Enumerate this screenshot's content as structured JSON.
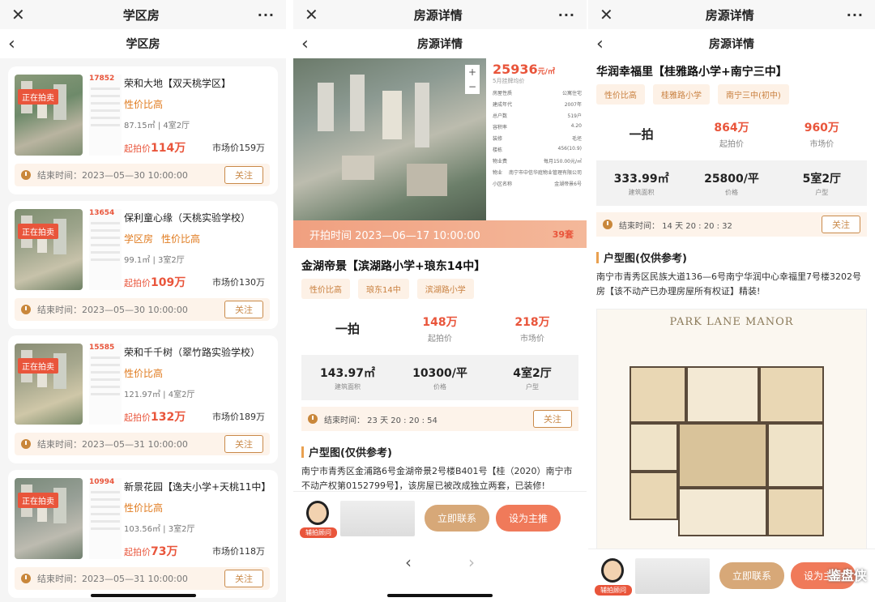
{
  "screen1": {
    "topbar_title": "学区房",
    "close_glyph": "✕",
    "more_glyph": "···",
    "nav_title": "学区房",
    "back_glyph": "‹",
    "cards": [
      {
        "badge": "正在拍卖",
        "doc_price": "17852",
        "title": "荣和大地【双天桃学区】",
        "tags": [
          "性价比高"
        ],
        "area": "87.15㎡",
        "layout": "4室2厅",
        "start_label": "起拍价",
        "start_price": "114万",
        "market": "市场价159万",
        "end": "结束时间：2023—05—30 10:00:00",
        "follow": "关注"
      },
      {
        "badge": "正在拍卖",
        "doc_price": "13654",
        "title": "保利童心缘（天桃实验学校）",
        "tags": [
          "学区房",
          "性价比高"
        ],
        "area": "99.1㎡",
        "layout": "3室2厅",
        "start_label": "起拍价",
        "start_price": "109万",
        "market": "市场价130万",
        "end": "结束时间：2023—05—30 10:00:00",
        "follow": "关注"
      },
      {
        "badge": "正在拍卖",
        "doc_price": "15585",
        "title": "荣和千千树（翠竹路实验学校）",
        "tags": [
          "性价比高"
        ],
        "area": "121.97㎡",
        "layout": "4室2厅",
        "start_label": "起拍价",
        "start_price": "132万",
        "market": "市场价189万",
        "end": "结束时间：2023—05—31 10:00:00",
        "follow": "关注"
      },
      {
        "badge": "正在拍卖",
        "doc_price": "10994",
        "title": "新景花园【逸夫小学+天桃11中】",
        "tags": [
          "性价比高"
        ],
        "area": "103.56㎡",
        "layout": "3室2厅",
        "start_label": "起拍价",
        "start_price": "73万",
        "market": "市场价118万",
        "end": "结束时间：2023—05—31 10:00:00",
        "follow": "关注"
      }
    ]
  },
  "screen2": {
    "topbar_title": "房源详情",
    "close_glyph": "✕",
    "more_glyph": "···",
    "nav_title": "房源详情",
    "back_glyph": "‹",
    "zoom_in": "+",
    "zoom_out": "−",
    "doc_price": "25936",
    "doc_unit": "元/㎡",
    "doc_sub": "5月挂牌均价",
    "doc_rows": [
      [
        "房屋性质",
        "公寓住宅"
      ],
      [
        "建成年代",
        "2007年"
      ],
      [
        "总户数",
        "519户"
      ],
      [
        "容积率",
        "4.20"
      ],
      [
        "装修",
        "毛坯"
      ],
      [
        "楼栋",
        "456(10.9)"
      ],
      [
        "物业费",
        "每月150.00元/㎡"
      ],
      [
        "物业",
        "南宁市中信华庭物业管理有限公司"
      ],
      [
        "小区名称",
        "金湖帝景6号"
      ]
    ],
    "banner": "开拍时间 2023—06—17 10:00:00",
    "banner_right": "39套",
    "title": "金湖帝景【滨湖路小学+琅东14中】",
    "tags": [
      "性价比高",
      "琅东14中",
      "滨湖路小学"
    ],
    "mode": "一拍",
    "start_price": "148万",
    "start_label": "起拍价",
    "market_price": "218万",
    "market_label": "市场价",
    "area": "143.97㎡",
    "area_label": "建筑面积",
    "unit_price": "10300/平",
    "unit_label": "价格",
    "layout": "4室2厅",
    "layout_label": "户型",
    "end": "结束时间： 23 天 20 : 20 : 54",
    "follow": "关注",
    "section": "户型图(仅供参考)",
    "desc": "南宁市青秀区金浦路6号金湖帝景2号楼B401号【桂（2020）南宁市不动产权第0152799号】，该房屋已被改成独立两套，已装修!",
    "advisor_label": "辅拍顾问",
    "contact_btn": "立即联系",
    "promote_btn": "设为主推",
    "prev_glyph": "‹",
    "next_glyph": "›"
  },
  "screen3": {
    "topbar_title": "房源详情",
    "close_glyph": "✕",
    "more_glyph": "···",
    "nav_title": "房源详情",
    "back_glyph": "‹",
    "title": "华润幸福里【桂雅路小学+南宁三中】",
    "tags": [
      "性价比高",
      "桂雅路小学",
      "南宁三中(初中)"
    ],
    "mode": "一拍",
    "start_price": "864万",
    "start_label": "起拍价",
    "market_price": "960万",
    "market_label": "市场价",
    "area": "333.99㎡",
    "area_label": "建筑面积",
    "unit_price": "25800/平",
    "unit_label": "价格",
    "layout": "5室2厅",
    "layout_label": "户型",
    "end": "结束时间： 14 天 20 : 20 : 32",
    "follow": "关注",
    "section": "户型图(仅供参考)",
    "desc": "南宁市青秀区民族大道136—6号南宁华润中心幸福里7号楼3202号房【该不动产已办理房屋所有权证】精装!",
    "floor_brand": "PARK LANE MANOR",
    "advisor_label": "辅拍顾问",
    "contact_btn": "立即联系",
    "promote_btn": "设为主推",
    "watermark": "鉴盘侠"
  }
}
